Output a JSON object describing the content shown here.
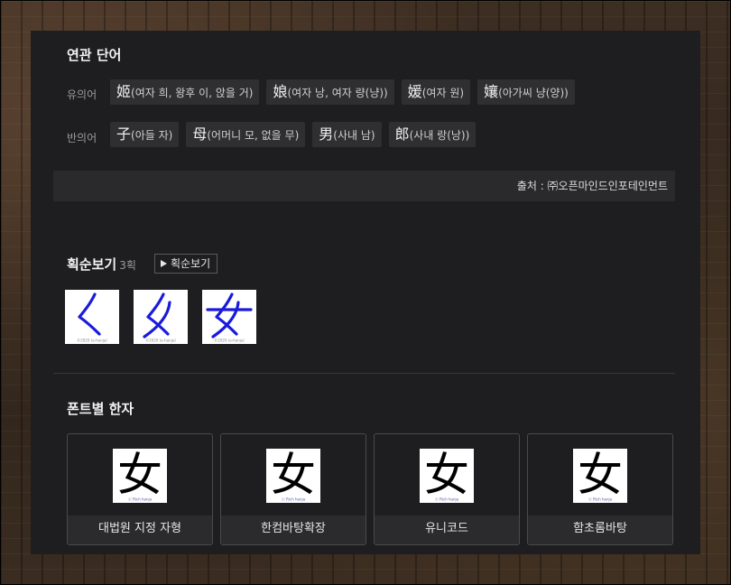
{
  "related": {
    "title": "연관 단어",
    "synonym_label": "유의어",
    "synonyms": [
      {
        "han": "姬",
        "reading": "(여자 희, 왕후 이, 앉을 거)"
      },
      {
        "han": "娘",
        "reading": "(여자 낭, 여자 량(냥))"
      },
      {
        "han": "媛",
        "reading": "(여자 원)"
      },
      {
        "han": "孃",
        "reading": "(아가씨 냥(양))"
      }
    ],
    "antonym_label": "반의어",
    "antonyms": [
      {
        "han": "子",
        "reading": "(아들 자)"
      },
      {
        "han": "母",
        "reading": "(어머니 모, 없을 무)"
      },
      {
        "han": "男",
        "reading": "(사내 남)"
      },
      {
        "han": "郎",
        "reading": "(사내 랑(낭))"
      }
    ],
    "source": "출처 : ㈜오픈마인드인포테인먼트"
  },
  "stroke_order": {
    "title": "획순보기",
    "count": "3획",
    "play_label": "획순보기",
    "copyright": "©2020 (e-hanja)",
    "stroke_color": "#1a1adb",
    "frames": [
      1,
      2,
      3
    ]
  },
  "fonts": {
    "title": "폰트별 한자",
    "character": "女",
    "watermark": "ⓒ Rich hanja",
    "cards": [
      {
        "name": "대법원 지정 자형"
      },
      {
        "name": "한컴바탕확장"
      },
      {
        "name": "유니코드"
      },
      {
        "name": "함초롬바탕"
      }
    ]
  }
}
